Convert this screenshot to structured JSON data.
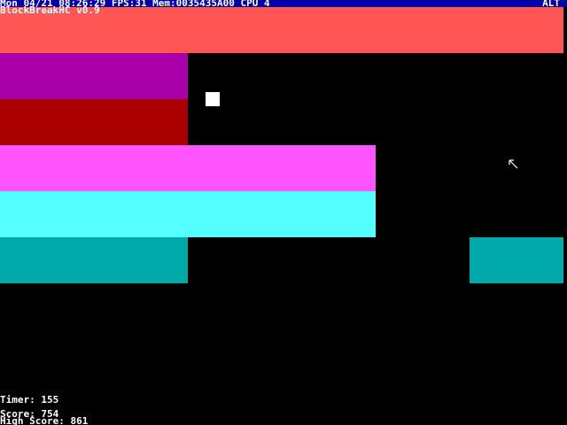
{
  "status_bar": {
    "text": "Mon 04/21 08:26:29 FPS:31 Mem:0035435A00 CPU 4",
    "alt_indicator": "ALT",
    "background_color": "#0000aa"
  },
  "game": {
    "title": "BlockBreakHC v0.9",
    "timer_text": "Timer: 155",
    "score_text": "Score: 754",
    "high_score_text": "High Score: 861",
    "background_color": "#000000",
    "ball_color": "#ffffff",
    "cursor_icon": "arrow-cursor-icon",
    "blocks": [
      {
        "row": 1,
        "color": "#ff5555"
      },
      {
        "row": 2,
        "color": "#aa00aa"
      },
      {
        "row": 3,
        "color": "#aa0000"
      },
      {
        "row": 4,
        "color": "#ff55ff"
      },
      {
        "row": 5,
        "color": "#55ffff"
      },
      {
        "row": 6,
        "color": "#00aaaa"
      },
      {
        "row": 6,
        "color": "#00aaaa"
      }
    ]
  }
}
